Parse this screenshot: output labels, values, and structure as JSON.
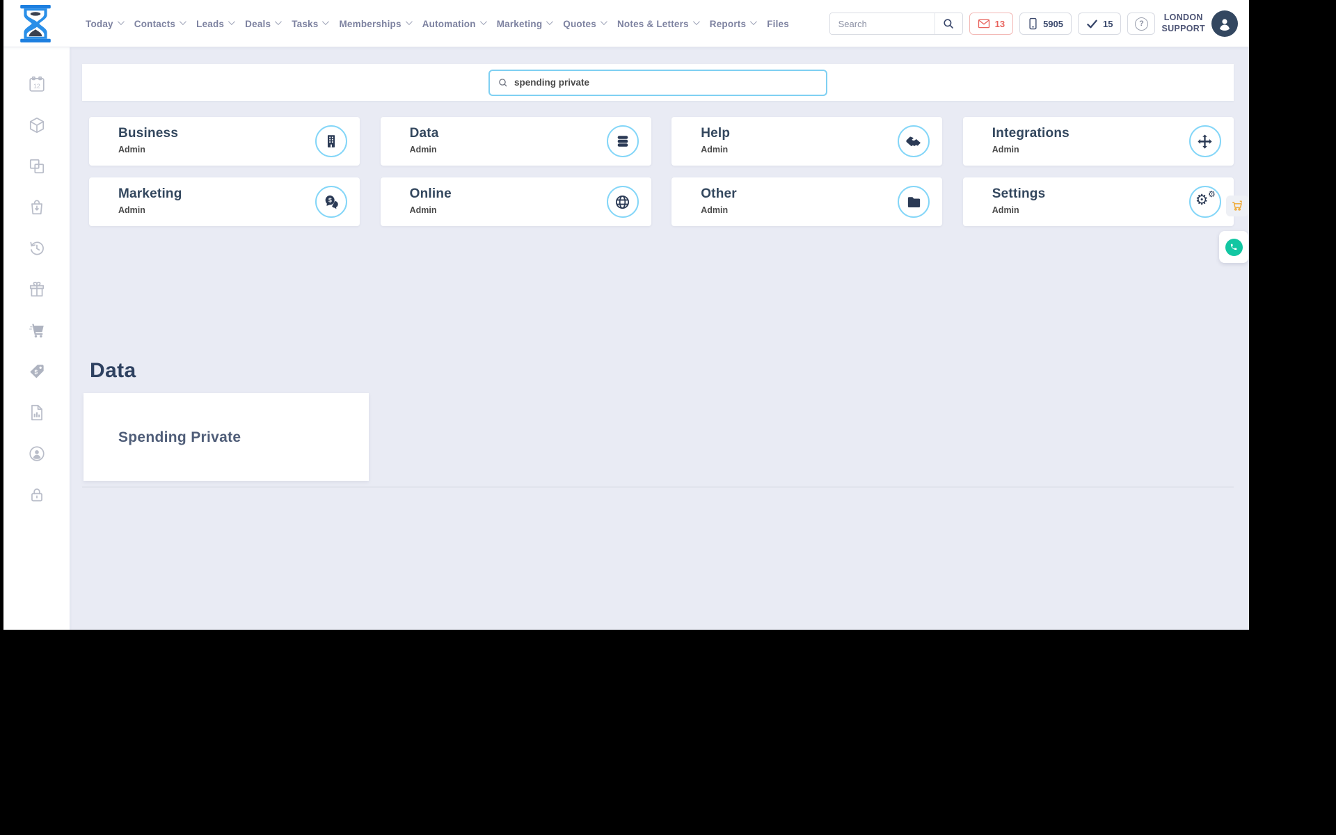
{
  "topbar": {
    "nav": [
      {
        "label": "Today"
      },
      {
        "label": "Contacts"
      },
      {
        "label": "Leads"
      },
      {
        "label": "Deals"
      },
      {
        "label": "Tasks"
      },
      {
        "label": "Memberships"
      },
      {
        "label": "Automation"
      },
      {
        "label": "Marketing"
      },
      {
        "label": "Quotes"
      },
      {
        "label": "Notes & Letters"
      },
      {
        "label": "Reports"
      },
      {
        "label": "Files"
      }
    ],
    "search_placeholder": "Search",
    "mail_count": "13",
    "phone_number": "5905",
    "task_count": "15",
    "help_glyph": "?",
    "account_line1": "LONDON",
    "account_line2": "SUPPORT"
  },
  "sidebar": {
    "calendar_number": "12",
    "icons": [
      "calendar-icon",
      "cube-icon",
      "copy-icon",
      "shopping-bag-icon",
      "history-icon",
      "gift-icon",
      "cart-icon",
      "price-tag-icon",
      "report-icon",
      "user-circle-icon",
      "lock-icon"
    ]
  },
  "main": {
    "search_value": "spending private",
    "cards": [
      {
        "title": "Business",
        "subtitle": "Admin",
        "icon": "building-icon"
      },
      {
        "title": "Data",
        "subtitle": "Admin",
        "icon": "database-icon"
      },
      {
        "title": "Help",
        "subtitle": "Admin",
        "icon": "handshake-icon"
      },
      {
        "title": "Integrations",
        "subtitle": "Admin",
        "icon": "move-arrows-icon"
      },
      {
        "title": "Marketing",
        "subtitle": "Admin",
        "icon": "money-chat-icon"
      },
      {
        "title": "Online",
        "subtitle": "Admin",
        "icon": "globe-icon"
      },
      {
        "title": "Other",
        "subtitle": "Admin",
        "icon": "folder-icon"
      },
      {
        "title": "Settings",
        "subtitle": "Admin",
        "icon": "gears-icon"
      }
    ],
    "dollar_glyph": "$",
    "gear_glyph": "⚙",
    "section": {
      "heading": "Data",
      "results": [
        {
          "title": "Spending Private"
        }
      ]
    }
  },
  "colors": {
    "accent_blue": "#2a8fe8",
    "icon_circle_border": "#84d6f8",
    "navy": "#2b3a55",
    "mail_red": "#e8625c",
    "orange": "#f0a62d",
    "teal": "#12c6a2",
    "page_bg": "#e9ebf4"
  }
}
